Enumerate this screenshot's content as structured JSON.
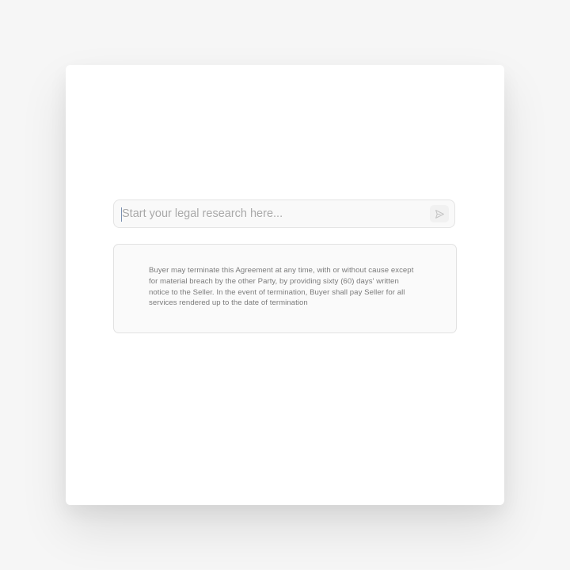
{
  "search": {
    "placeholder": "Start your legal research here...",
    "value": "",
    "send_icon": "send-icon"
  },
  "clause": {
    "lines": [
      "Buyer may terminate this Agreement at any time, with or without cause except",
      "for material breach by the other Party, by providing sixty (60) days' written",
      "notice to the Seller. In the event of termination, Buyer shall pay Seller for all",
      "services rendered up to the date of termination"
    ]
  },
  "colors": {
    "background": "#f6f6f6",
    "card": "#ffffff",
    "border": "#e4e4e4",
    "text_muted": "#7b7b7b"
  }
}
